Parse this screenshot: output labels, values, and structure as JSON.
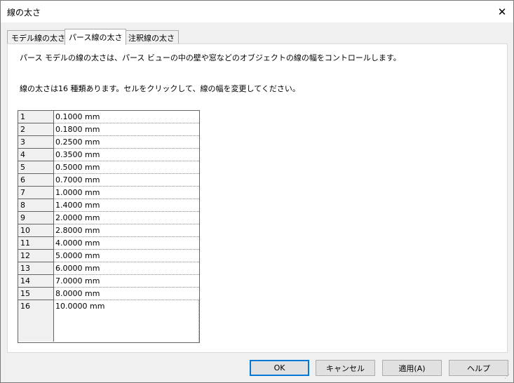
{
  "window": {
    "title": "線の太さ",
    "close_icon": "close-icon",
    "close_glyph": "✕"
  },
  "tabs": [
    {
      "label": "モデル線の太さ",
      "active": false
    },
    {
      "label": "パース線の太さ",
      "active": true
    },
    {
      "label": "注釈線の太さ",
      "active": false
    }
  ],
  "panel": {
    "description": "パース モデルの線の太さは、パース ビューの中の壁や窓などのオブジェクトの線の幅をコントロールします。",
    "instruction": "線の太さは16 種類あります。セルをクリックして、線の幅を変更してください。"
  },
  "grid": {
    "rows": [
      {
        "num": "1",
        "value": "0.1000 mm"
      },
      {
        "num": "2",
        "value": "0.1800 mm"
      },
      {
        "num": "3",
        "value": "0.2500 mm"
      },
      {
        "num": "4",
        "value": "0.3500 mm"
      },
      {
        "num": "5",
        "value": "0.5000 mm"
      },
      {
        "num": "6",
        "value": "0.7000 mm"
      },
      {
        "num": "7",
        "value": "1.0000 mm"
      },
      {
        "num": "8",
        "value": "1.4000 mm"
      },
      {
        "num": "9",
        "value": "2.0000 mm"
      },
      {
        "num": "10",
        "value": "2.8000 mm"
      },
      {
        "num": "11",
        "value": "4.0000 mm"
      },
      {
        "num": "12",
        "value": "5.0000 mm"
      },
      {
        "num": "13",
        "value": "6.0000 mm"
      },
      {
        "num": "14",
        "value": "7.0000 mm"
      },
      {
        "num": "15",
        "value": "8.0000 mm"
      },
      {
        "num": "16",
        "value": "10.0000 mm"
      }
    ]
  },
  "buttons": {
    "ok": "OK",
    "cancel": "キャンセル",
    "apply": "適用(A)",
    "help": "ヘルプ"
  },
  "colors": {
    "accent": "#0078d7",
    "panel_bg": "#ffffff",
    "dialog_bg": "#f0f0f0"
  }
}
